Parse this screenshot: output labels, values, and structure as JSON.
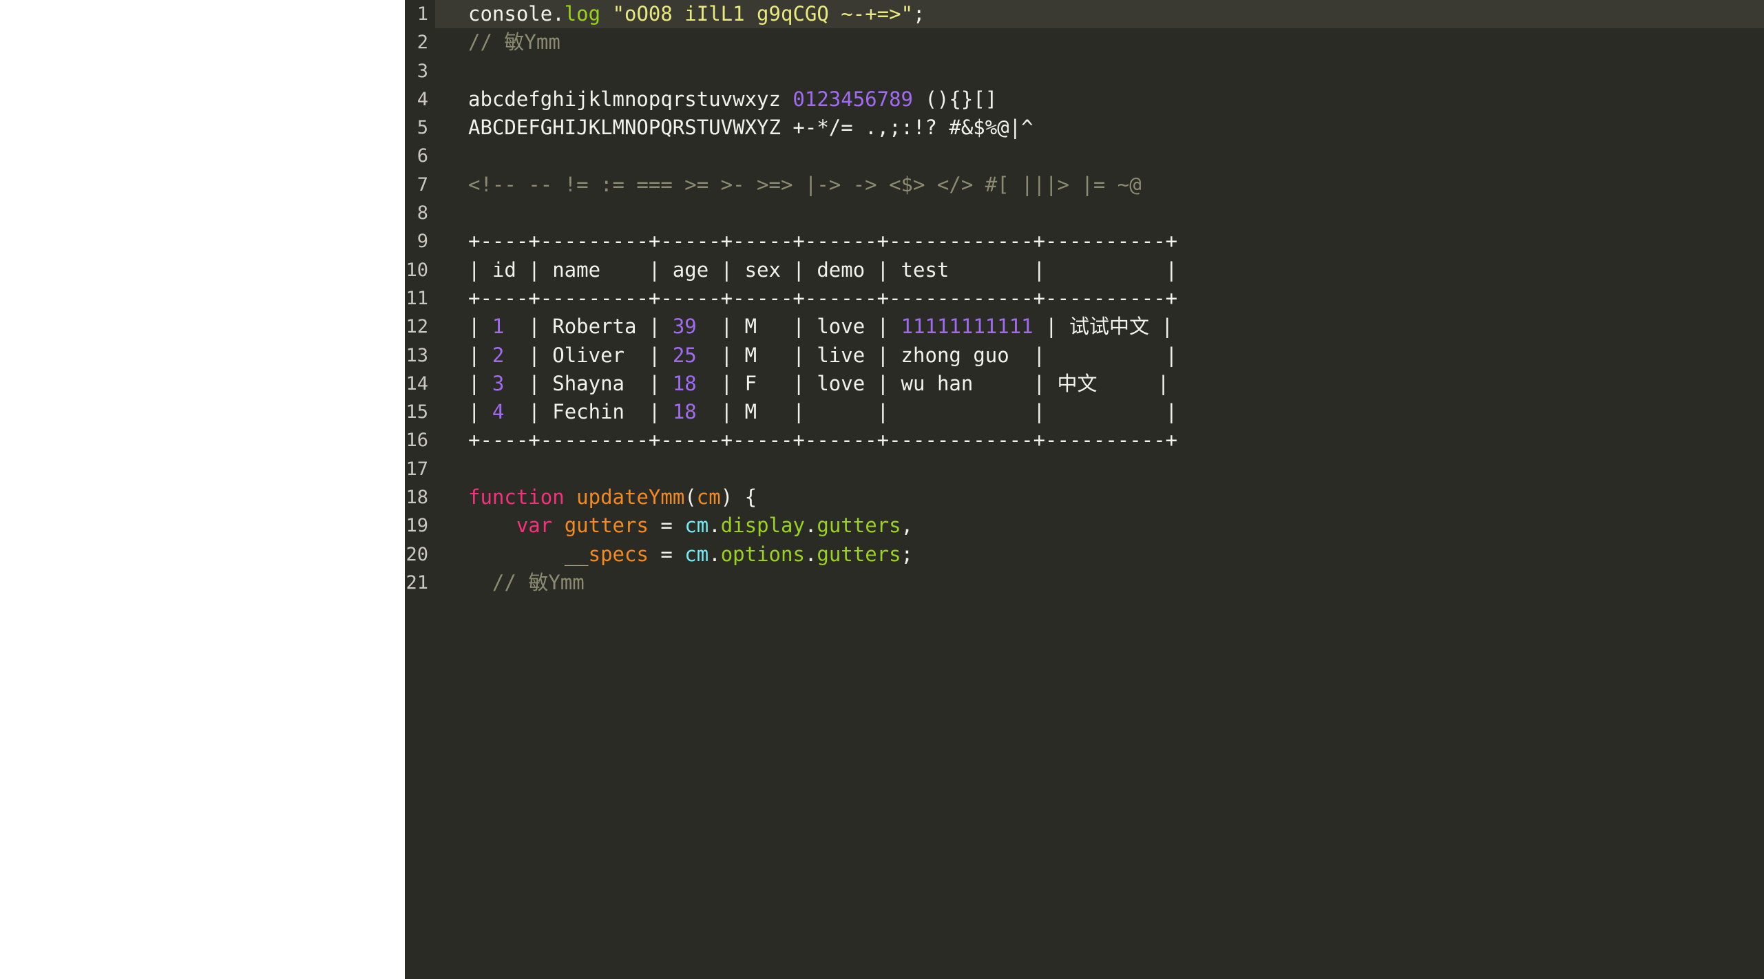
{
  "editor": {
    "theme_name": "dark",
    "background": "#2b2b26",
    "active_line_background": "#3a3a33",
    "gutter_color": "#c9c9c1",
    "page_background": "#ffffff",
    "active_line": 1,
    "palette": {
      "default": "#f2f2ec",
      "string": "#e9e97e",
      "number": "#a06bf0",
      "comment": "#8b8b71",
      "keyword": "#f6307c",
      "variable": "#f58a1f",
      "property": "#9ad21c",
      "cyan": "#73e9f2"
    },
    "lines": [
      {
        "number": "1",
        "active": true,
        "tokens": [
          {
            "text": "console.",
            "cls": "t-def"
          },
          {
            "text": "log",
            "cls": "t-prop"
          },
          {
            "text": " ",
            "cls": "t-def"
          },
          {
            "text": "\"oO08 iIlL1 g9qCGQ ~-+=>\"",
            "cls": "t-string"
          },
          {
            "text": ";",
            "cls": "t-punct"
          }
        ]
      },
      {
        "number": "2",
        "active": false,
        "tokens": [
          {
            "text": "// ",
            "cls": "t-comment"
          },
          {
            "text": "敏",
            "cls": "t-comment cjk"
          },
          {
            "text": "Ymm",
            "cls": "t-comment"
          }
        ]
      },
      {
        "number": "3",
        "active": false,
        "tokens": []
      },
      {
        "number": "4",
        "active": false,
        "tokens": [
          {
            "text": "abcdefghijklmnopqrstuvwxyz ",
            "cls": "t-def"
          },
          {
            "text": "0123456789",
            "cls": "t-num"
          },
          {
            "text": " (){}[]",
            "cls": "t-def"
          }
        ]
      },
      {
        "number": "5",
        "active": false,
        "tokens": [
          {
            "text": "ABCDEFGHIJKLMNOPQRSTUVWXYZ +-*/= .,;:!? #&$%@|^",
            "cls": "t-def"
          }
        ]
      },
      {
        "number": "6",
        "active": false,
        "tokens": []
      },
      {
        "number": "7",
        "active": false,
        "tokens": [
          {
            "text": "<!-- -- != := === >= >- >=> |-> -> <$> </> #[ |||> |= ~@",
            "cls": "t-op"
          }
        ]
      },
      {
        "number": "8",
        "active": false,
        "tokens": []
      },
      {
        "number": "9",
        "active": false,
        "tokens": [
          {
            "text": "+----+---------+-----+-----+------+------------+----------+",
            "cls": "t-def"
          }
        ]
      },
      {
        "number": "10",
        "active": false,
        "tokens": [
          {
            "text": "| id | name    | age | sex | demo | test       |          |",
            "cls": "t-def"
          }
        ]
      },
      {
        "number": "11",
        "active": false,
        "tokens": [
          {
            "text": "+----+---------+-----+-----+------+------------+----------+",
            "cls": "t-def"
          }
        ]
      },
      {
        "number": "12",
        "active": false,
        "tokens": [
          {
            "text": "| ",
            "cls": "t-def"
          },
          {
            "text": "1",
            "cls": "t-num"
          },
          {
            "text": "  | Roberta | ",
            "cls": "t-def"
          },
          {
            "text": "39",
            "cls": "t-num"
          },
          {
            "text": "  | M   | love | ",
            "cls": "t-def"
          },
          {
            "text": "11111111111",
            "cls": "t-num"
          },
          {
            "text": " | ",
            "cls": "t-def"
          },
          {
            "text": "试试中文",
            "cls": "t-def cjk"
          },
          {
            "text": " |",
            "cls": "t-def"
          }
        ]
      },
      {
        "number": "13",
        "active": false,
        "tokens": [
          {
            "text": "| ",
            "cls": "t-def"
          },
          {
            "text": "2",
            "cls": "t-num"
          },
          {
            "text": "  | Oliver  | ",
            "cls": "t-def"
          },
          {
            "text": "25",
            "cls": "t-num"
          },
          {
            "text": "  | M   | live | zhong guo  |          |",
            "cls": "t-def"
          }
        ]
      },
      {
        "number": "14",
        "active": false,
        "tokens": [
          {
            "text": "| ",
            "cls": "t-def"
          },
          {
            "text": "3",
            "cls": "t-num"
          },
          {
            "text": "  | Shayna  | ",
            "cls": "t-def"
          },
          {
            "text": "18",
            "cls": "t-num"
          },
          {
            "text": "  | F   | love | wu han     | ",
            "cls": "t-def"
          },
          {
            "text": "中文",
            "cls": "t-def cjk"
          },
          {
            "text": "     |",
            "cls": "t-def"
          }
        ]
      },
      {
        "number": "15",
        "active": false,
        "tokens": [
          {
            "text": "| ",
            "cls": "t-def"
          },
          {
            "text": "4",
            "cls": "t-num"
          },
          {
            "text": "  | Fechin  | ",
            "cls": "t-def"
          },
          {
            "text": "18",
            "cls": "t-num"
          },
          {
            "text": "  | M   |      |            |          |",
            "cls": "t-def"
          }
        ]
      },
      {
        "number": "16",
        "active": false,
        "tokens": [
          {
            "text": "+----+---------+-----+-----+------+------------+----------+",
            "cls": "t-def"
          }
        ]
      },
      {
        "number": "17",
        "active": false,
        "tokens": []
      },
      {
        "number": "18",
        "active": false,
        "tokens": [
          {
            "text": "function",
            "cls": "t-kw"
          },
          {
            "text": " ",
            "cls": "t-def"
          },
          {
            "text": "updateYmm",
            "cls": "t-var"
          },
          {
            "text": "(",
            "cls": "t-punct"
          },
          {
            "text": "cm",
            "cls": "t-var"
          },
          {
            "text": ") {",
            "cls": "t-punct"
          }
        ]
      },
      {
        "number": "19",
        "active": false,
        "tokens": [
          {
            "text": "    ",
            "cls": "t-def"
          },
          {
            "text": "var",
            "cls": "t-kw"
          },
          {
            "text": " ",
            "cls": "t-def"
          },
          {
            "text": "gutters",
            "cls": "t-var"
          },
          {
            "text": " = ",
            "cls": "t-punct"
          },
          {
            "text": "cm",
            "cls": "t-cyan"
          },
          {
            "text": ".",
            "cls": "t-punct"
          },
          {
            "text": "display",
            "cls": "t-prop"
          },
          {
            "text": ".",
            "cls": "t-punct"
          },
          {
            "text": "gutters",
            "cls": "t-prop"
          },
          {
            "text": ",",
            "cls": "t-punct"
          }
        ]
      },
      {
        "number": "20",
        "active": false,
        "tokens": [
          {
            "text": "        ",
            "cls": "t-def"
          },
          {
            "text": "__specs",
            "cls": "t-var"
          },
          {
            "text": " = ",
            "cls": "t-punct"
          },
          {
            "text": "cm",
            "cls": "t-cyan"
          },
          {
            "text": ".",
            "cls": "t-punct"
          },
          {
            "text": "options",
            "cls": "t-prop"
          },
          {
            "text": ".",
            "cls": "t-punct"
          },
          {
            "text": "gutters",
            "cls": "t-prop"
          },
          {
            "text": ";",
            "cls": "t-punct"
          }
        ]
      },
      {
        "number": "21",
        "active": false,
        "tokens": [
          {
            "text": "  // ",
            "cls": "t-comment"
          },
          {
            "text": "敏",
            "cls": "t-comment cjk"
          },
          {
            "text": "Ymm",
            "cls": "t-comment"
          }
        ]
      }
    ]
  }
}
